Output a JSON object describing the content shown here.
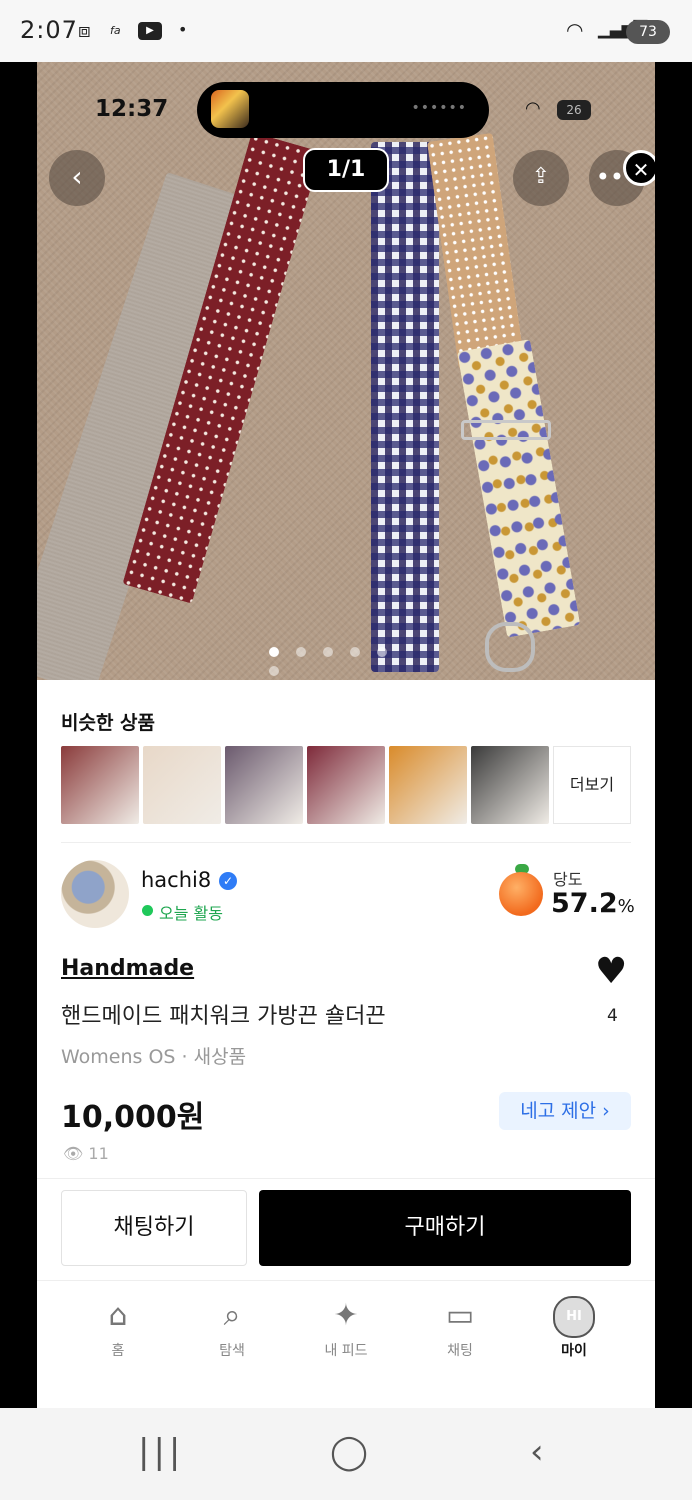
{
  "status_bar": {
    "time": "2:07",
    "notif_icons": [
      "screenshot-icon",
      "app-icon",
      "youtube-icon",
      "dot-icon"
    ],
    "battery": "73"
  },
  "inner_status": {
    "time": "12:37",
    "battery": "26"
  },
  "photo": {
    "counter": "1/1",
    "page_index": 0,
    "page_count": 6
  },
  "similar": {
    "title": "비슷한 상품",
    "more_label": "더보기",
    "thumb_colors": [
      "#8a3b3b",
      "#e8d8c8",
      "#6b5a6e",
      "#7e2a3a",
      "#d98b2b",
      "#3a3a3a"
    ]
  },
  "seller": {
    "name": "hachi8",
    "activity": "오늘 활동",
    "temp_label": "당도",
    "temp_value": "57.2",
    "temp_unit": "%"
  },
  "product": {
    "brand": "Handmade",
    "title": "핸드메이드 패치워크 가방끈 숄더끈",
    "meta": "Womens OS · 새상품",
    "price": "10,000원",
    "offer_label": "네고 제안 ›",
    "views": "11",
    "likes": "4"
  },
  "actions": {
    "chat_label": "채팅하기",
    "buy_label": "구매하기"
  },
  "bottom_nav": [
    {
      "label": "홈",
      "icon": "home-icon"
    },
    {
      "label": "탐색",
      "icon": "search-icon"
    },
    {
      "label": "내 피드",
      "icon": "sparkle-icon"
    },
    {
      "label": "채팅",
      "icon": "chat-icon"
    },
    {
      "label": "마이",
      "icon": "avatar-icon",
      "avatar_text": "HI"
    }
  ]
}
